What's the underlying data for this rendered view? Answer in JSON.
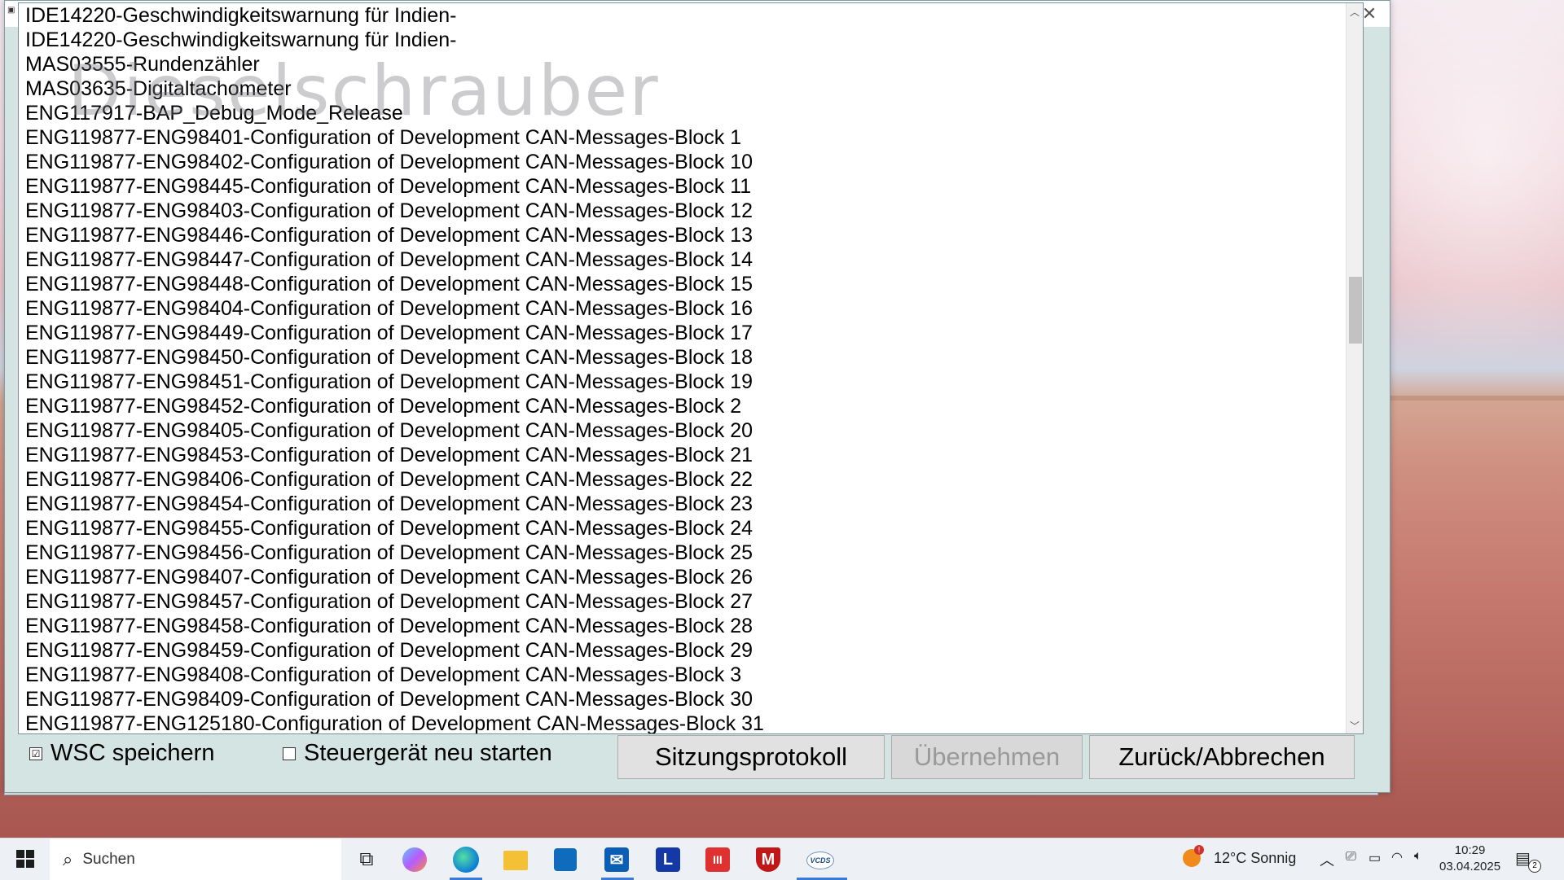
{
  "watermark": "Dieselschrauber",
  "list": {
    "items": [
      "IDE14220-Geschwindigkeitswarnung für Indien-",
      "IDE14220-Geschwindigkeitswarnung für Indien-",
      "MAS03555-Rundenzähler",
      "MAS03635-Digitaltachometer",
      "ENG117917-BAP_Debug_Mode_Release",
      "ENG119877-ENG98401-Configuration of Development CAN-Messages-Block 1",
      "ENG119877-ENG98402-Configuration of Development CAN-Messages-Block 10",
      "ENG119877-ENG98445-Configuration of Development CAN-Messages-Block 11",
      "ENG119877-ENG98403-Configuration of Development CAN-Messages-Block 12",
      "ENG119877-ENG98446-Configuration of Development CAN-Messages-Block 13",
      "ENG119877-ENG98447-Configuration of Development CAN-Messages-Block 14",
      "ENG119877-ENG98448-Configuration of Development CAN-Messages-Block 15",
      "ENG119877-ENG98404-Configuration of Development CAN-Messages-Block 16",
      "ENG119877-ENG98449-Configuration of Development CAN-Messages-Block 17",
      "ENG119877-ENG98450-Configuration of Development CAN-Messages-Block 18",
      "ENG119877-ENG98451-Configuration of Development CAN-Messages-Block 19",
      "ENG119877-ENG98452-Configuration of Development CAN-Messages-Block 2",
      "ENG119877-ENG98405-Configuration of Development CAN-Messages-Block 20",
      "ENG119877-ENG98453-Configuration of Development CAN-Messages-Block 21",
      "ENG119877-ENG98406-Configuration of Development CAN-Messages-Block 22",
      "ENG119877-ENG98454-Configuration of Development CAN-Messages-Block 23",
      "ENG119877-ENG98455-Configuration of Development CAN-Messages-Block 24",
      "ENG119877-ENG98456-Configuration of Development CAN-Messages-Block 25",
      "ENG119877-ENG98407-Configuration of Development CAN-Messages-Block 26",
      "ENG119877-ENG98457-Configuration of Development CAN-Messages-Block 27",
      "ENG119877-ENG98458-Configuration of Development CAN-Messages-Block 28",
      "ENG119877-ENG98459-Configuration of Development CAN-Messages-Block 29",
      "ENG119877-ENG98408-Configuration of Development CAN-Messages-Block 3",
      "ENG119877-ENG98409-Configuration of Development CAN-Messages-Block 30",
      "ENG119877-ENG125180-Configuration of Development CAN-Messages-Block 31"
    ]
  },
  "bottom": {
    "wsc_save": {
      "label": "WSC speichern",
      "checked": true,
      "mark": "☑"
    },
    "restart_ecu": {
      "label": "Steuergerät neu starten",
      "checked": false
    },
    "session_log_label": "Sitzungsprotokoll",
    "apply_label": "Übernehmen",
    "back_cancel_label": "Zurück/Abbrechen"
  },
  "taskbar": {
    "search_placeholder": "Suchen",
    "apps": [
      "task-view",
      "copilot",
      "edge",
      "file-explorer",
      "microsoft-store",
      "outlook",
      "l-app",
      "red-app",
      "mcafee",
      "vcds"
    ],
    "l_app_letter": "L",
    "red_app_glyph": "III",
    "mcafee_letter": "M",
    "vcds_label": "VCDS",
    "weather": "12°C  Sonnig",
    "weather_badge": "!",
    "time": "10:29",
    "date": "03.04.2025",
    "notifications_count": "2"
  },
  "colors": {
    "edge_blue": "#0c7bd8",
    "store_blue": "#0f6cbd",
    "outlook_blue": "#0a5fb5",
    "l_app_navy": "#1438a6",
    "red_app": "#e03131",
    "mcafee_red": "#c01818"
  }
}
